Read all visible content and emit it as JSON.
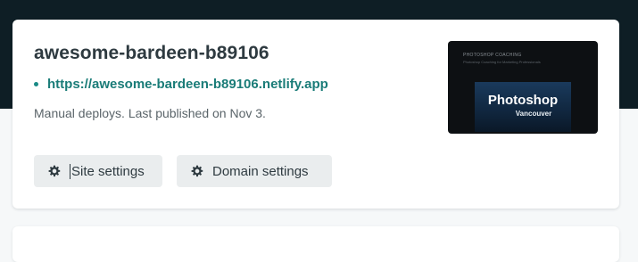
{
  "site": {
    "name": "awesome-bardeen-b89106",
    "url": "https://awesome-bardeen-b89106.netlify.app",
    "status": "Manual deploys. Last published on Nov 3."
  },
  "preview": {
    "header": "PHOTOSHOP COACHING",
    "subheader": "Photoshop Coaching for Marketing Professionals",
    "title": "Photoshop",
    "subtitle": "Vancouver"
  },
  "actions": {
    "site_settings_label": "Site settings",
    "domain_settings_label": "Domain settings"
  },
  "icons": {
    "settings": "gear-icon"
  },
  "colors": {
    "header_background": "#0e1e25",
    "link_teal": "#1a7c78",
    "button_background": "#eaedee"
  }
}
